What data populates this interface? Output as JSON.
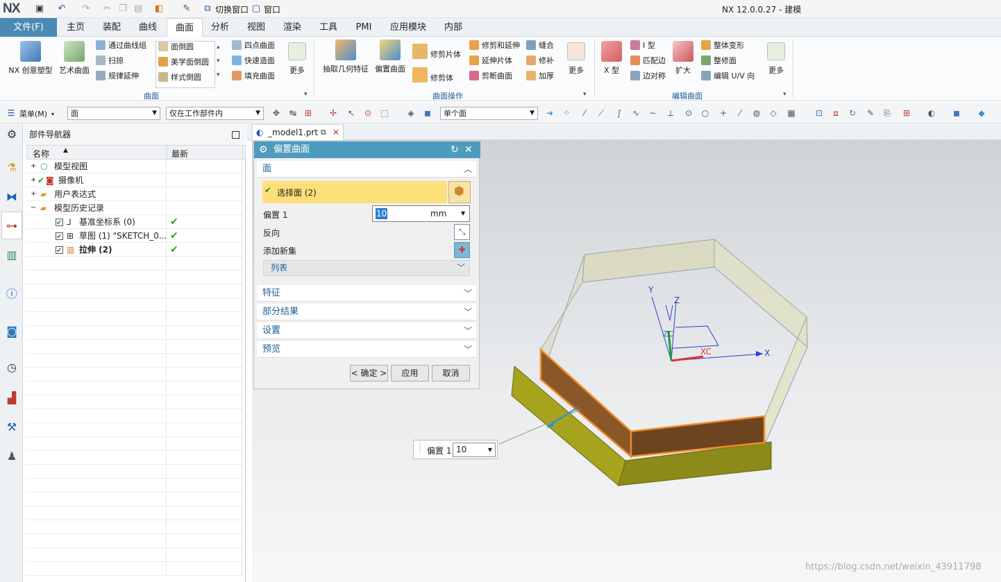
{
  "titlebar": {
    "logo": "NX",
    "switch_window": "切换窗口",
    "window_menu": "窗口",
    "app_title": "NX 12.0.0.27 - 建模"
  },
  "menubar": {
    "file": "文件(F)",
    "tabs": [
      "主页",
      "装配",
      "曲线",
      "曲面",
      "分析",
      "视图",
      "渲染",
      "工具",
      "PMI",
      "应用模块",
      "内部"
    ],
    "active_tab": "曲面"
  },
  "ribbon": {
    "group1": {
      "label": "曲面",
      "big": [
        "NX 创意塑型",
        "艺术曲面"
      ],
      "small": [
        "通过曲线组",
        "扫掠",
        "规律延伸",
        "面倒圆",
        "美学面倒圆",
        "样式倒圆",
        "四点曲面",
        "快速造面",
        "填充曲面"
      ],
      "more": "更多"
    },
    "group2": {
      "label": "曲面操作",
      "big": [
        "抽取几何特征",
        "偏置曲面"
      ],
      "small": [
        "修剪片体",
        "修剪体",
        "修剪和延伸",
        "延伸片体",
        "剪断曲面",
        "缝合",
        "修补",
        "加厚"
      ],
      "more": "更多"
    },
    "group3": {
      "label": "编辑曲面",
      "big": [
        "X 型",
        "扩大"
      ],
      "small": [
        "I 型",
        "匹配边",
        "边对称",
        "整体变形",
        "整修面",
        "编辑 U/V 向"
      ],
      "more": "更多"
    }
  },
  "toolbar": {
    "menu_label": "菜单(M)",
    "filter_type": "面",
    "filter_scope": "仅在工作部件内",
    "select_rule": "单个面"
  },
  "navigator": {
    "title": "部件导航器",
    "col_name": "名称",
    "col_latest": "最新",
    "rows": [
      {
        "label": "模型视图",
        "level": 1,
        "latest": ""
      },
      {
        "label": "摄像机",
        "level": 1,
        "latest": ""
      },
      {
        "label": "用户表达式",
        "level": 1,
        "latest": ""
      },
      {
        "label": "模型历史记录",
        "level": 1,
        "latest": ""
      },
      {
        "label": "基准坐标系 (0)",
        "level": 2,
        "latest": "✔"
      },
      {
        "label": "草图 (1) \"SKETCH_0...",
        "level": 2,
        "latest": "✔"
      },
      {
        "label": "拉伸 (2)",
        "level": 2,
        "latest": "✔"
      }
    ]
  },
  "doc_tab": "_model1.prt",
  "dialog": {
    "title": "偏置曲面",
    "sec_face": "面",
    "select_face": "选择面 (2)",
    "offset_label": "偏置 1",
    "offset_value": "10",
    "unit": "mm",
    "reverse": "反向",
    "add_new_set": "添加新集",
    "list": "列表",
    "sec_feature": "特征",
    "sec_partial": "部分结果",
    "sec_settings": "设置",
    "sec_preview": "预览",
    "ok": "< 确定 >",
    "apply": "应用",
    "cancel": "取消"
  },
  "graphics": {
    "offset_tag_label": "偏置 1",
    "offset_tag_value": "10",
    "axis_labels": [
      "Y",
      "Z",
      "ZC",
      "XC",
      "X"
    ]
  },
  "watermark": "https://blog.csdn.net/weixin_43911798",
  "colors": {
    "accent": "#4a8ab5",
    "dialog_title": "#4e9cbd",
    "highlight": "#fde07a",
    "offset_face": "#a3a020",
    "selected_face": "#7a4a24"
  }
}
